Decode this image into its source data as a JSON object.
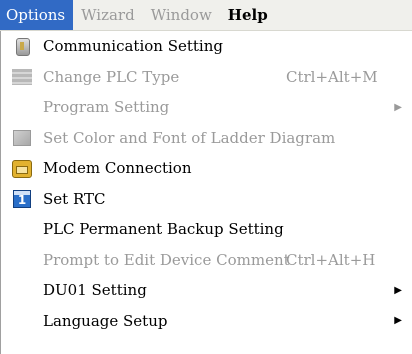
{
  "menubar": {
    "items": [
      {
        "label": "Options",
        "state": "active"
      },
      {
        "label": "Wizard",
        "state": "disabled"
      },
      {
        "label": "Window",
        "state": "disabled"
      },
      {
        "label": "Help",
        "state": "bold"
      }
    ]
  },
  "menu": {
    "items": [
      {
        "label": "Communication Setting",
        "icon": "communication-icon",
        "enabled": true
      },
      {
        "label": "Change PLC Type",
        "shortcut": "Ctrl+Alt+M",
        "icon": "plc-type-icon",
        "enabled": false
      },
      {
        "label": "Program Setting",
        "submenu": true,
        "enabled": false
      },
      {
        "label": "Set Color and Font of Ladder Diagram",
        "icon": "color-font-icon",
        "enabled": false
      },
      {
        "label": "Modem Connection",
        "icon": "modem-icon",
        "enabled": true
      },
      {
        "label": "Set RTC",
        "icon": "rtc-icon",
        "icon_text": "1",
        "enabled": true
      },
      {
        "label": "PLC Permanent Backup Setting",
        "enabled": true
      },
      {
        "label": "Prompt to Edit Device Comment",
        "shortcut": "Ctrl+Alt+H",
        "enabled": false
      },
      {
        "label": "DU01 Setting",
        "submenu": true,
        "enabled": true
      },
      {
        "label": "Language Setup",
        "submenu": true,
        "enabled": true
      }
    ]
  },
  "colors": {
    "menubar_bg": "#f0f0ec",
    "active_bg": "#316ac5",
    "disabled_text": "#9a9a9a"
  }
}
